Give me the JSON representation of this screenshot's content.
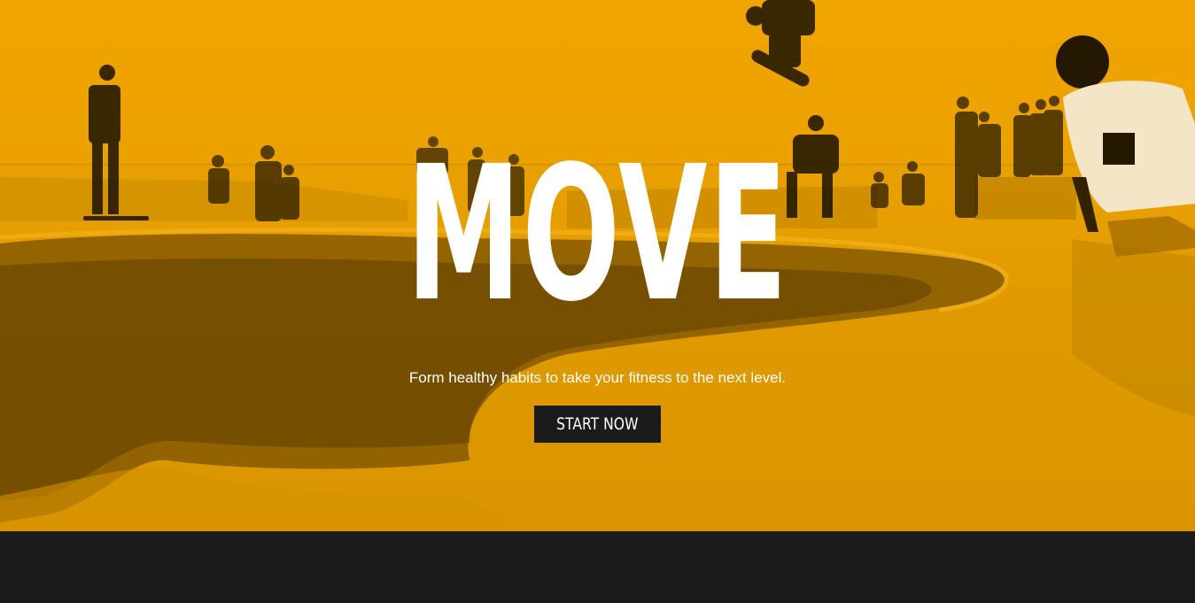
{
  "hero": {
    "title": "MOVE",
    "subtitle": "Form healthy habits to take your fitness to the next level.",
    "cta_label": "START NOW"
  },
  "theme": {
    "overlay_color": "#f0a500",
    "button_color": "#1b1b1c",
    "footer_color": "#1b1b1c",
    "text_color": "#ffffff"
  }
}
